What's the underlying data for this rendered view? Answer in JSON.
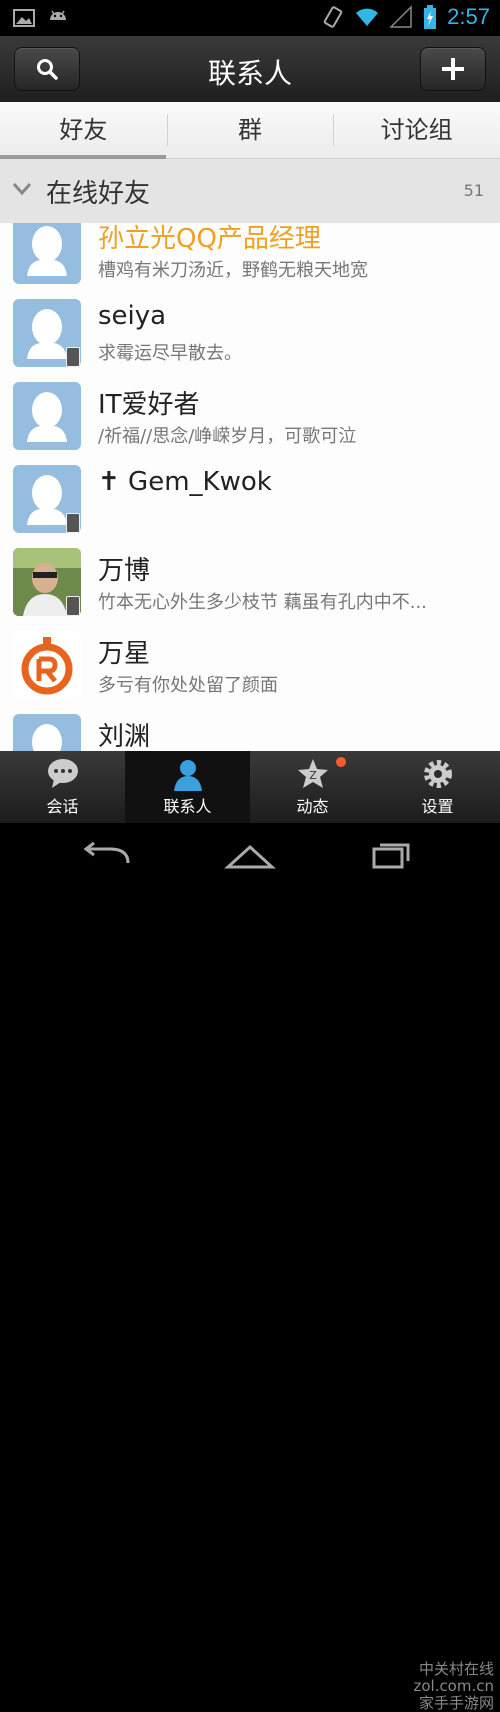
{
  "status_bar": {
    "time": "2:57"
  },
  "header": {
    "title": "联系人"
  },
  "tabs": [
    {
      "label": "好友"
    },
    {
      "label": "群"
    },
    {
      "label": "讨论组"
    }
  ],
  "group": {
    "title": "在线好友",
    "count": "51"
  },
  "contacts": [
    {
      "name": "孙立光QQ产品经理",
      "signature": "槽鸡有米刀汤近，野鹤无粮天地宽",
      "name_color": "#f0a020"
    },
    {
      "name": "seiya",
      "signature": "求霉运尽早散去。"
    },
    {
      "name": "IT爱好者",
      "signature": "/祈福//思念/峥嵘岁月，可歌可泣"
    },
    {
      "name": "✝ Gem_Kwok",
      "signature": ""
    },
    {
      "name": "万博",
      "signature": "竹本无心外生多少枝节  藕虽有孔内中不..."
    },
    {
      "name": "万星",
      "signature": "多亏有你处处留了颜面"
    },
    {
      "name": "刘渊",
      "signature": ""
    }
  ],
  "bottom_nav": [
    {
      "label": "会话"
    },
    {
      "label": "联系人"
    },
    {
      "label": "动态"
    },
    {
      "label": "设置"
    }
  ],
  "watermark": {
    "line1": "中关村在线",
    "line2": "zol.com.cn",
    "line3": "家手手游网"
  },
  "colors": {
    "accent": "#33b5e5",
    "highlight_name": "#f0a020",
    "avatar_default": "#95bde0"
  }
}
